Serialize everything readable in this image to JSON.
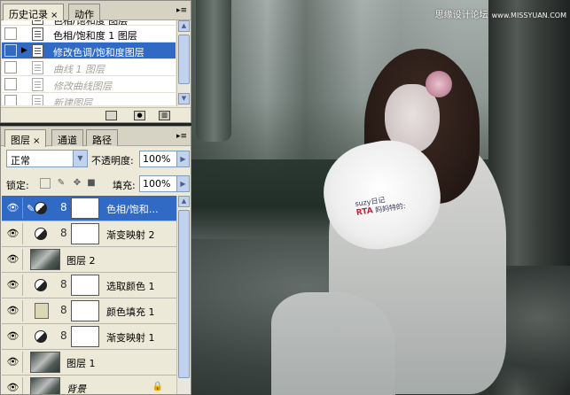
{
  "history_panel": {
    "tabs": [
      {
        "label": "历史记录",
        "active": true
      },
      {
        "label": "动作",
        "active": false
      }
    ],
    "close_glyph": "×",
    "menu_glyph": "▸≡",
    "items": [
      {
        "label": "色相/饱和度 图层",
        "state": "normal",
        "partial": true
      },
      {
        "label": "色相/饱和度 1 图层",
        "state": "normal"
      },
      {
        "label": "修改色调/饱和度图层",
        "state": "selected"
      },
      {
        "label": "曲线 1 图层",
        "state": "dim"
      },
      {
        "label": "修改曲线图层",
        "state": "dim"
      },
      {
        "label": "新建图层",
        "state": "dim"
      }
    ],
    "footer_icons": [
      "new-document-from-state-icon",
      "snapshot-camera-icon",
      "trash-icon"
    ]
  },
  "layers_panel": {
    "tabs": [
      {
        "label": "图层",
        "active": true
      },
      {
        "label": "通道",
        "active": false
      },
      {
        "label": "路径",
        "active": false
      }
    ],
    "close_glyph": "×",
    "menu_glyph": "▸≡",
    "blend_mode": "正常",
    "opacity_label": "不透明度:",
    "opacity_value": "100%",
    "lock_label": "锁定:",
    "fill_label": "填充:",
    "fill_value": "100%",
    "layers": [
      {
        "name": "色相/饱和…",
        "type": "adjustment",
        "selected": true
      },
      {
        "name": "渐变映射 2",
        "type": "adjustment",
        "selected": false
      },
      {
        "name": "图层 2",
        "type": "photo",
        "selected": false
      },
      {
        "name": "选取颜色 1",
        "type": "adjustment",
        "selected": false
      },
      {
        "name": "颜色填充 1",
        "type": "fill",
        "selected": false,
        "fill_color": "#dcd7b4"
      },
      {
        "name": "渐变映射 1",
        "type": "adjustment",
        "selected": false
      },
      {
        "name": "图层 1",
        "type": "photo",
        "selected": false
      },
      {
        "name": "背景",
        "type": "background",
        "selected": false
      }
    ]
  },
  "photo": {
    "watermark_text": "思缘设计论坛",
    "watermark_url": "www.MISSYUAN.COM",
    "pillow_brand": "suzy日记",
    "pillow_logo": "RTA",
    "pillow_tagline": "妈妈特的:"
  },
  "colors": {
    "selection": "#316ac5",
    "panel_bg": "#ece9d8"
  }
}
